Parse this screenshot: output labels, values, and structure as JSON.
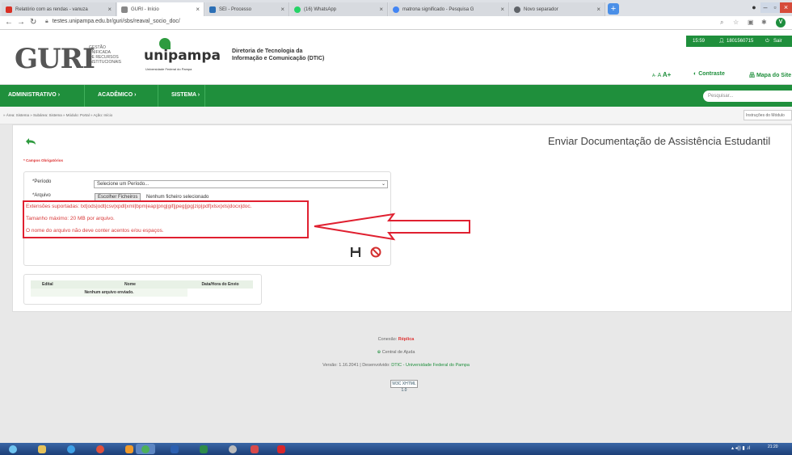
{
  "browser": {
    "tabs": [
      {
        "title": "Relatório com as rendas - vanuza",
        "icon": "gmail-icon",
        "color": "#d93025",
        "active": false
      },
      {
        "title": "GURI - Início",
        "icon": "guri-icon",
        "color": "#888888",
        "active": true
      },
      {
        "title": "SEI - Processo",
        "icon": "sei-icon",
        "color": "#2c6fb5",
        "active": false
      },
      {
        "title": "(16) WhatsApp",
        "icon": "whatsapp-icon",
        "color": "#25d366",
        "active": false
      },
      {
        "title": "matrona significado - Pesquisa G",
        "icon": "google-icon",
        "color": "#4285f4",
        "active": false
      },
      {
        "title": "Novo separador",
        "icon": "chrome-icon",
        "color": "#5f6368",
        "active": false
      }
    ],
    "new_tab": "+",
    "url": "testes.unipampa.edu.br/guri/sbs/reaval_socio_doc/",
    "profile_letter": "V"
  },
  "header": {
    "logo": "GURI",
    "logo_sub": [
      "GESTÃO",
      "UNIFICADA",
      "DE RECURSOS",
      "INSTITUCIONAIS"
    ],
    "unipampa": "unipampa",
    "unipampa_sub": "Universidade Federal do Pampa",
    "dtic_line1": "Diretoria de Tecnologia da",
    "dtic_line2": "Informação e Comunicação (DTIC)",
    "time": "15:59",
    "user_id": "1801560715",
    "exit": "Sair",
    "font_small": "A-",
    "font_normal": "A",
    "font_large": "A+",
    "contrast": "Contraste",
    "sitemap": "Mapa do Site"
  },
  "menu": {
    "items": [
      "ADMINISTRATIVO ›",
      "ACADÊMICO ›",
      "SISTEMA ›"
    ],
    "search_placeholder": "Pesquisar..."
  },
  "breadcrumb": {
    "text": "» Área: Sistema » Subárea: Sistema » Módulo: Portal » Ação: Início",
    "instructions": "Instruções do Módulo"
  },
  "page": {
    "title": "Enviar Documentação de Assistência Estudantil",
    "required_note": "* Campos Obrigatórios",
    "period_label": "*Período",
    "period_value": "Selecione um Período...",
    "file_label": "*Arquivo",
    "file_button": "Escolher Ficheiros",
    "file_name": "Nenhum ficheiro selecionado",
    "ext_line": "Extensões suportadas: txt|ods|odt|csv|xpdl|xml|bpm|eap|png|gif|jpeg|jpg|zip|pdf|xlsx|xls|docx|doc.",
    "size_line": "Tamanho máximo: 20 MB por arquivo.",
    "name_line": "O nome do arquivo não deve conter acentos e/ou espaços.",
    "table_headers": [
      "Edital",
      "Nome",
      "Data/Hora do Envio"
    ],
    "table_empty": "Nenhum arquivo enviado."
  },
  "footer": {
    "connection_label": "Conexão:",
    "connection_value": "Réplica",
    "help": "Central de Ajuda",
    "version_prefix": "Versão: 1.16.2041 | Desenvolvido:",
    "version_link": "DTIC - Universidade Federal do Pampa",
    "w3c": "W3C XHTML 1.0"
  },
  "taskbar": {
    "time": "21:20"
  },
  "colors": {
    "brand_green": "#1f8f3c",
    "highlight_red": "#e02030",
    "warning_text": "#d93a3a"
  }
}
